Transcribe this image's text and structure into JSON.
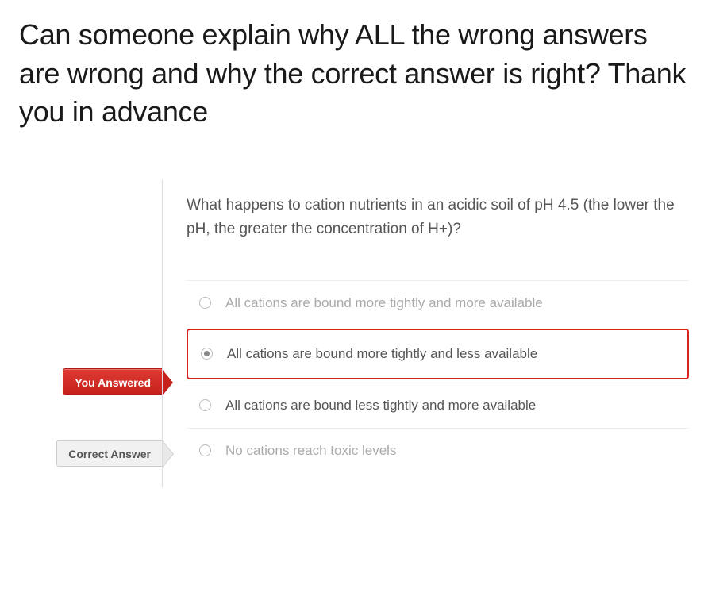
{
  "post": {
    "title": "Can someone explain why ALL the wrong answers are wrong and why the correct answer is right? Thank you in advance"
  },
  "quiz": {
    "question": "What happens to cation nutrients in an acidic soil of pH 4.5 (the lower the pH, the greater the concentration of H+)?",
    "labels": {
      "you_answered": "You Answered",
      "correct_answer": "Correct Answer"
    },
    "options": [
      {
        "text": "All cations are bound more tightly and more available"
      },
      {
        "text": "All cations are bound more tightly and less available"
      },
      {
        "text": "All cations are bound less tightly and more available"
      },
      {
        "text": "No cations reach toxic levels"
      }
    ]
  }
}
